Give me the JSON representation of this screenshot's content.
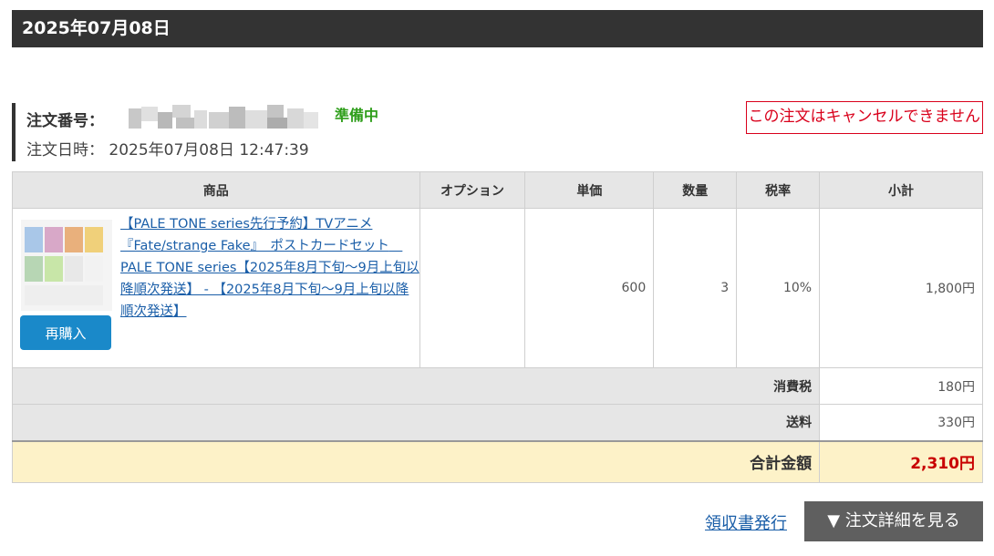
{
  "header": {
    "date": "2025年07月08日"
  },
  "order": {
    "number_label": "注文番号：",
    "status": "準備中",
    "datetime_label": "注文日時：",
    "datetime": "2025年07月08日 12:47:39",
    "cancel_notice": "この注文はキャンセルできません"
  },
  "table": {
    "headers": [
      "商品",
      "オプション",
      "単価",
      "数量",
      "税率",
      "小計"
    ],
    "item": {
      "title": "【PALE TONE series先行予約】TVアニメ『Fate/strange Fake』　ポストカードセット　PALE TONE series【2025年8月下旬～9月上旬以降順次発送】 - 【2025年8月下旬～9月上旬以降順次発送】",
      "option": "",
      "unit_price": "600",
      "quantity": "3",
      "tax_rate": "10%",
      "subtotal": "1,800円",
      "rebuy_label": "再購入",
      "thumbnail_icon": "product-thumbnail"
    },
    "tax_label": "消費税",
    "tax_value": "180円",
    "shipping_label": "送料",
    "shipping_value": "330円",
    "total_label": "合計金額",
    "total_value": "2,310円"
  },
  "footer": {
    "receipt_link": "領収書発行",
    "detail_button": "▼ 注文詳細を見る"
  },
  "colors": {
    "header_bg": "#333333",
    "status_green": "#2e9e1a",
    "cancel_red": "#d9001b",
    "link_blue": "#1a5ea8",
    "button_blue": "#1a89c9",
    "total_bg": "#fdf2c8",
    "total_red": "#c80000",
    "detail_btn_bg": "#5f5f5f"
  }
}
